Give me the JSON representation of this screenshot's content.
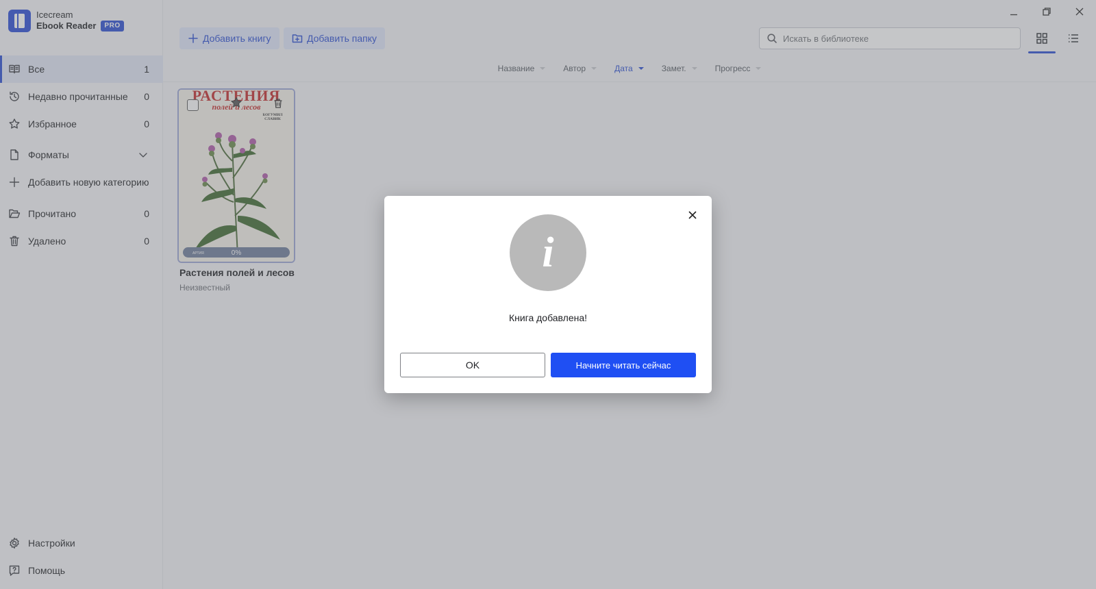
{
  "app": {
    "name_line1": "Icecream",
    "name_line2": "Ebook Reader",
    "badge": "PRO",
    "accent_color": "#2b4ed3"
  },
  "sidebar": {
    "items": [
      {
        "label": "Все",
        "count": "1",
        "icon": "book-open-icon",
        "active": true
      },
      {
        "label": "Недавно прочитанные",
        "count": "0",
        "icon": "history-icon"
      },
      {
        "label": "Избранное",
        "count": "0",
        "icon": "star-icon"
      },
      {
        "label": "Форматы",
        "count": "",
        "icon": "file-icon",
        "expandable": true
      },
      {
        "label": "Добавить новую категорию",
        "count": "",
        "icon": "plus-icon"
      },
      {
        "label": "Прочитано",
        "count": "0",
        "icon": "folder-open-icon"
      },
      {
        "label": "Удалено",
        "count": "0",
        "icon": "trash-icon"
      }
    ],
    "footer": [
      {
        "label": "Настройки",
        "icon": "gear-icon"
      },
      {
        "label": "Помощь",
        "icon": "help-icon"
      }
    ]
  },
  "toolbar": {
    "add_book": "Добавить книгу",
    "add_folder": "Добавить папку",
    "search_placeholder": "Искать в библиотеке"
  },
  "sort": {
    "columns": [
      {
        "label": "Название",
        "active": false
      },
      {
        "label": "Автор",
        "active": false
      },
      {
        "label": "Дата",
        "active": true
      },
      {
        "label": "Замет.",
        "active": false
      },
      {
        "label": "Прогресс",
        "active": false
      }
    ]
  },
  "books": [
    {
      "title": "Растения полей и лесов",
      "author": "Неизвестный",
      "progress": "0%",
      "progress_fraction": 0,
      "cover_title": "РАСТЕНИЯ",
      "cover_subtitle": "полей и лесов",
      "cover_author": "БОГУМИЛ СЛАВИК",
      "cover_publisher": "АРТИЯ"
    }
  ],
  "dialog": {
    "message": "Книга добавлена!",
    "ok_label": "OK",
    "read_label": "Начните читать сейчас",
    "icon_glyph": "i"
  }
}
